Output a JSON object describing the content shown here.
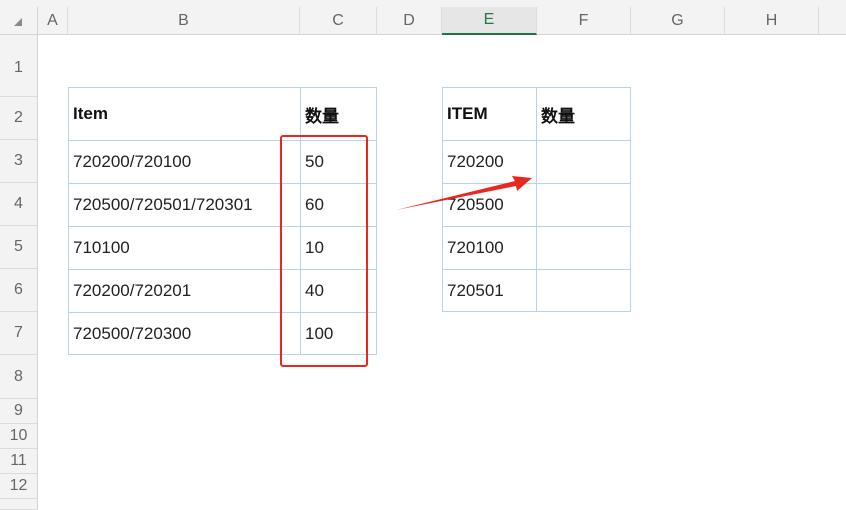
{
  "columns": [
    "A",
    "B",
    "C",
    "D",
    "E",
    "F",
    "G",
    "H"
  ],
  "selected_column": "E",
  "rows": [
    "1",
    "2",
    "3",
    "4",
    "5",
    "6",
    "7",
    "8",
    "9",
    "10",
    "11",
    "12"
  ],
  "left_table": {
    "headers": [
      "Item",
      "数量"
    ],
    "rows": [
      [
        "720200/720100",
        "50"
      ],
      [
        "720500/720501/720301",
        "60"
      ],
      [
        "710100",
        "10"
      ],
      [
        "720200/720201",
        "40"
      ],
      [
        "720500/720300",
        "100"
      ]
    ]
  },
  "right_table": {
    "headers": [
      "ITEM",
      "数量"
    ],
    "rows": [
      [
        "720200",
        ""
      ],
      [
        "720500",
        ""
      ],
      [
        "720100",
        ""
      ],
      [
        "720501",
        ""
      ]
    ]
  },
  "annotation": {
    "box_color": "#e8281f",
    "arrow_color": "#e8281f"
  }
}
